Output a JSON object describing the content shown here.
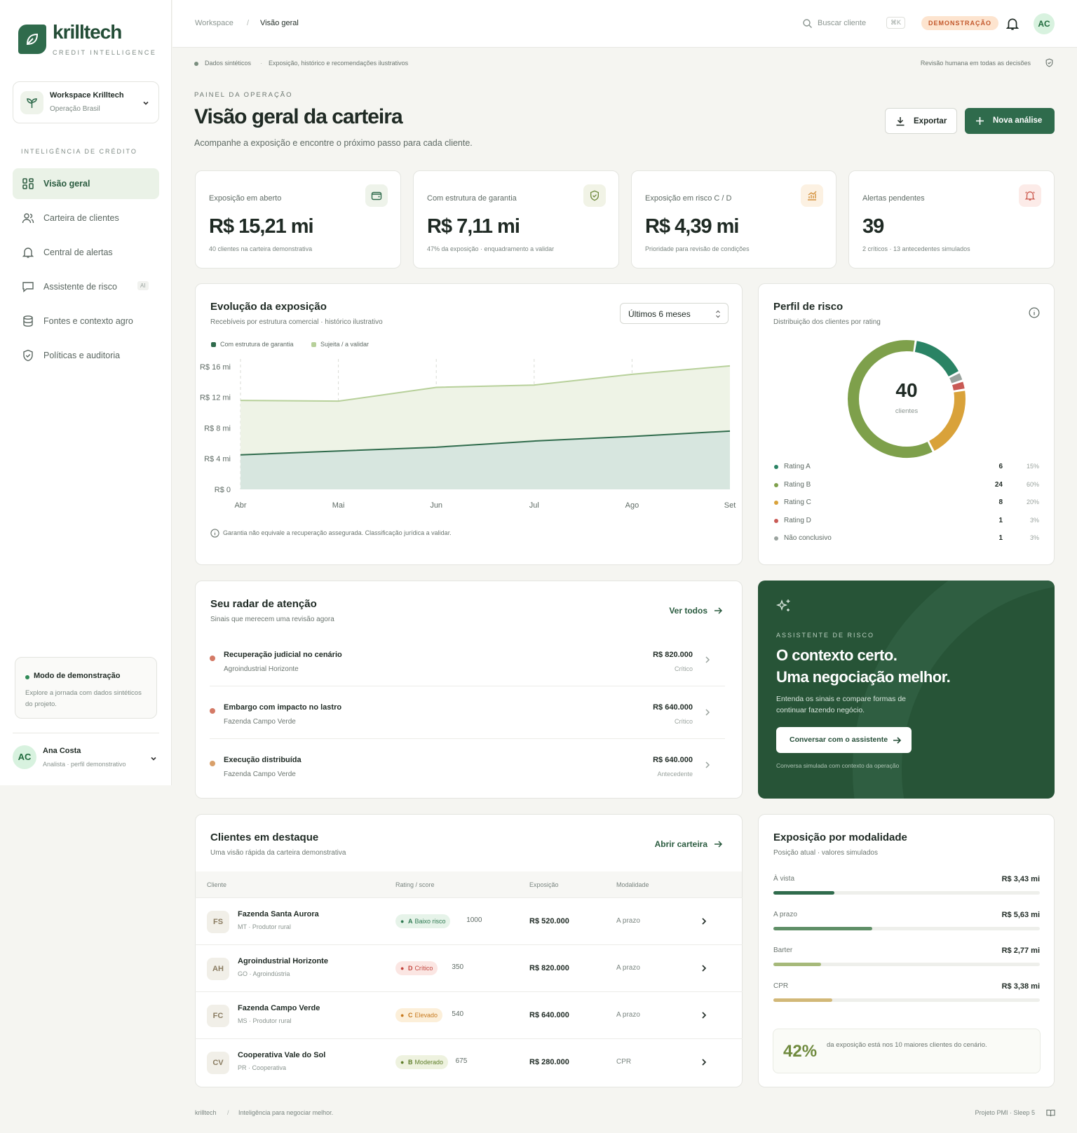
{
  "brand": {
    "name": "krilltech",
    "tagline": "CREDIT INTELLIGENCE"
  },
  "workspace": {
    "title": "Workspace Krilltech",
    "subtitle": "Operação Brasil"
  },
  "sidebar": {
    "section_title": "INTELIGÊNCIA DE CRÉDITO",
    "items": [
      {
        "label": "Visão geral",
        "icon": "grid-icon",
        "active": true
      },
      {
        "label": "Carteira de clientes",
        "icon": "users-icon"
      },
      {
        "label": "Central de alertas",
        "icon": "bell-icon"
      },
      {
        "label": "Assistente de risco",
        "icon": "chat-icon",
        "badge": "AI"
      },
      {
        "label": "Fontes e contexto agro",
        "icon": "database-icon"
      },
      {
        "label": "Políticas e auditoria",
        "icon": "shield-icon"
      }
    ],
    "demo": {
      "title": "Modo de demonstração",
      "description": "Explore a jornada com dados sintéticos do projeto."
    },
    "user": {
      "initials": "AC",
      "name": "Ana Costa",
      "role": "Analista · perfil demonstrativo"
    }
  },
  "topbar": {
    "breadcrumb": [
      "Workspace",
      "/",
      "Visão geral"
    ],
    "search_placeholder": "Buscar cliente",
    "shortcut": "⌘K",
    "demo_badge": "DEMONSTRAÇÃO",
    "avatar": "AC"
  },
  "banner": {
    "left": "Dados sintéticos",
    "sep": "·",
    "middle": "Exposição, histórico e recomendações ilustrativos",
    "right": "Revisão humana em todas as decisões"
  },
  "header": {
    "eyebrow": "PAINEL DA OPERAÇÃO",
    "title": "Visão geral da carteira",
    "subtitle": "Acompanhe a exposição e encontre o próximo passo para cada cliente.",
    "export_label": "Exportar",
    "new_label": "Nova análise"
  },
  "kpis": [
    {
      "title": "Exposição em aberto",
      "value": "R$ 15,21 mi",
      "note": "40 clientes na carteira demonstrativa",
      "icon": "wallet-icon",
      "color": "#2f6b4c",
      "bg": "#eef3ea"
    },
    {
      "title": "Com estrutura de garantia",
      "value": "R$ 7,11 mi",
      "note": "47% da exposição · enquadramento a validar",
      "icon": "shield-check-icon",
      "color": "#6f8a3e",
      "bg": "#f1f3e6"
    },
    {
      "title": "Exposição em risco C / D",
      "value": "R$ 4,39 mi",
      "note": "Prioridade para revisão de condições",
      "icon": "chart-up-icon",
      "color": "#d4913c",
      "bg": "#fcf1e2"
    },
    {
      "title": "Alertas pendentes",
      "value": "39",
      "note": "2 críticos · 13 antecedentes simulados",
      "icon": "bell-alert-icon",
      "color": "#cc5a4e",
      "bg": "#fcebe8"
    }
  ],
  "evolution": {
    "title": "Evolução da exposição",
    "subtitle": "Recebíveis por estrutura comercial · histórico ilustrativo",
    "period": "Últimos 6 meses",
    "note": "Garantia não equivale a recuperação assegurada. Classificação jurídica a validar."
  },
  "chart_data": {
    "type": "area",
    "categories": [
      "Abr",
      "Mai",
      "Jun",
      "Jul",
      "Ago",
      "Set"
    ],
    "series": [
      {
        "name": "Com estrutura de garantia",
        "values": [
          4.5,
          5.0,
          5.5,
          6.3,
          6.9,
          7.6
        ],
        "color": "#2f6b4c"
      },
      {
        "name": "Sujeita / a validar",
        "values": [
          11.6,
          11.5,
          13.3,
          13.6,
          15.0,
          16.1
        ],
        "color": "#b7d09a"
      }
    ],
    "ylim": [
      0,
      17
    ],
    "yticks": [
      0,
      4,
      8,
      12,
      16
    ],
    "ytick_labels": [
      "R$ 0",
      "R$ 4 mi",
      "R$ 8 mi",
      "R$ 12 mi",
      "R$ 16 mi"
    ]
  },
  "risk": {
    "title": "Perfil de risco",
    "subtitle": "Distribuição dos clientes por rating",
    "total": "40",
    "total_label": "clientes",
    "ratings": [
      {
        "label": "Rating A",
        "count": 6,
        "pct": "15%",
        "color": "#2a8364"
      },
      {
        "label": "Rating B",
        "count": 24,
        "pct": "60%",
        "color": "#7ea04b"
      },
      {
        "label": "Rating C",
        "count": 8,
        "pct": "20%",
        "color": "#d9a23a"
      },
      {
        "label": "Rating D",
        "count": 1,
        "pct": "3%",
        "color": "#c95a55"
      },
      {
        "label": "Não conclusivo",
        "count": 1,
        "pct": "3%",
        "color": "#9aa39e"
      }
    ]
  },
  "radar": {
    "title": "Seu radar de atenção",
    "subtitle": "Sinais que merecem uma revisão agora",
    "link": "Ver todos",
    "items": [
      {
        "title": "Recuperação judicial no cenário",
        "client": "Agroindustrial Horizonte",
        "amount": "R$ 820.000",
        "level": "Crítico",
        "color": "#d47a66"
      },
      {
        "title": "Embargo com impacto no lastro",
        "client": "Fazenda Campo Verde",
        "amount": "R$ 640.000",
        "level": "Crítico",
        "color": "#d47a66"
      },
      {
        "title": "Execução distribuída",
        "client": "Fazenda Campo Verde",
        "amount": "R$ 640.000",
        "level": "Antecedente",
        "color": "#d9a06a"
      }
    ]
  },
  "assistant": {
    "eyebrow": "ASSISTENTE DE RISCO",
    "headline_1": "O contexto certo.",
    "headline_2": "Uma negociação melhor.",
    "description": "Entenda os sinais e compare formas de continuar fazendo negócio.",
    "cta": "Conversar com o assistente",
    "footnote": "Conversa simulada com contexto da operação"
  },
  "clients": {
    "title": "Clientes em destaque",
    "subtitle": "Uma visão rápida da carteira demonstrativa",
    "link": "Abrir carteira",
    "columns": [
      "Cliente",
      "Rating / score",
      "Exposição",
      "Modalidade"
    ],
    "rows": [
      {
        "initials": "FS",
        "name": "Fazenda Santa Aurora",
        "location": "MT · Produtor rural",
        "grade": "A",
        "label": "Baixo risco",
        "score": "1000",
        "exposure": "R$ 520.000",
        "modality": "A prazo",
        "fg": "#2f7a52",
        "bg": "#e6f3e9"
      },
      {
        "initials": "AH",
        "name": "Agroindustrial Horizonte",
        "location": "GO · Agroindústria",
        "grade": "D",
        "label": "Crítico",
        "score": "350",
        "exposure": "R$ 820.000",
        "modality": "A prazo",
        "fg": "#c2453e",
        "bg": "#fbe6e3"
      },
      {
        "initials": "FC",
        "name": "Fazenda Campo Verde",
        "location": "MS · Produtor rural",
        "grade": "C",
        "label": "Elevado",
        "score": "540",
        "exposure": "R$ 640.000",
        "modality": "A prazo",
        "fg": "#c77a1f",
        "bg": "#fcefd9"
      },
      {
        "initials": "CV",
        "name": "Cooperativa Vale do Sol",
        "location": "PR · Cooperativa",
        "grade": "B",
        "label": "Moderado",
        "score": "675",
        "exposure": "R$ 280.000",
        "modality": "CPR",
        "fg": "#5f7e2a",
        "bg": "#eef2df"
      }
    ]
  },
  "modality": {
    "title": "Exposição por modalidade",
    "subtitle": "Posição atual · valores simulados",
    "items": [
      {
        "label": "À vista",
        "value": "R$ 3,43 mi",
        "fraction": 0.23,
        "color": "#2f6b4c"
      },
      {
        "label": "A prazo",
        "value": "R$ 5,63 mi",
        "fraction": 0.37,
        "color": "#5f8f67"
      },
      {
        "label": "Barter",
        "value": "R$ 2,77 mi",
        "fraction": 0.18,
        "color": "#a6b97a"
      },
      {
        "label": "CPR",
        "value": "R$ 3,38 mi",
        "fraction": 0.22,
        "color": "#d2b878"
      }
    ],
    "insight_value": "42%",
    "insight_text": "da exposição está nos 10 maiores clientes do cenário."
  },
  "footer": {
    "brand": "krilltech",
    "sep": "/",
    "tagline": "Inteligência para negociar melhor.",
    "right": "Projeto PMI · Sleep 5"
  }
}
